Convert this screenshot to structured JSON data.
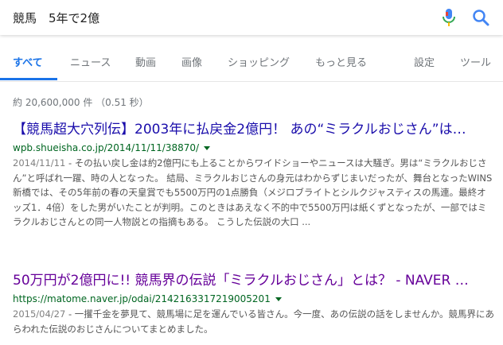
{
  "search": {
    "query": "競馬　5年で2億"
  },
  "tabs": [
    {
      "label": "すべて"
    },
    {
      "label": "ニュース"
    },
    {
      "label": "動画"
    },
    {
      "label": "画像"
    },
    {
      "label": "ショッピング"
    },
    {
      "label": "もっと見る"
    },
    {
      "label": "設定"
    },
    {
      "label": "ツール"
    }
  ],
  "stats": "約 20,600,000 件 （0.51 秒）",
  "results": [
    {
      "title": "【競馬超大穴列伝】2003年に払戻金2億円！ あの“ミラクルおじさん”は…",
      "url": "wpb.shueisha.co.jp/2014/11/11/38870/",
      "date": "2014/11/11",
      "snippet": " - その払い戻し金は約2億円にも上ることからワイドショーやニュースは大騒ぎ。男は“ミラクルおじさん”と呼ばれ一躍、時の人となった。 結局、ミラクルおじさんの身元はわからずじまいだったが、舞台となったWINS新橋では、その5年前の春の天皇賞でも5500万円の1点勝負（メジロブライトとシルクジャスティスの馬連。最終オッズ1．4倍）をした男がいたことが判明。このときはあえなく不的中で5500万円は紙くずとなったが、一部ではミラクルおじさんとの同一人物説との指摘もある。 こうした伝説の大口 ..."
    },
    {
      "title": "50万円が2億円に!! 競馬界の伝説「ミラクルおじさん」とは？ - NAVER …",
      "url": "https://matome.naver.jp/odai/2142163317219005201",
      "date": "2015/04/27",
      "snippet": " - 一攫千金を夢見て、競馬場に足を運んでいる皆さん。今一度、あの伝説の話をしませんか。競馬界にあらわれた伝説のおじさんについてまとめました。"
    }
  ],
  "colors": {
    "accent": "#1a73e8",
    "link": "#1a0dab",
    "visited": "#660099",
    "url": "#006621"
  }
}
